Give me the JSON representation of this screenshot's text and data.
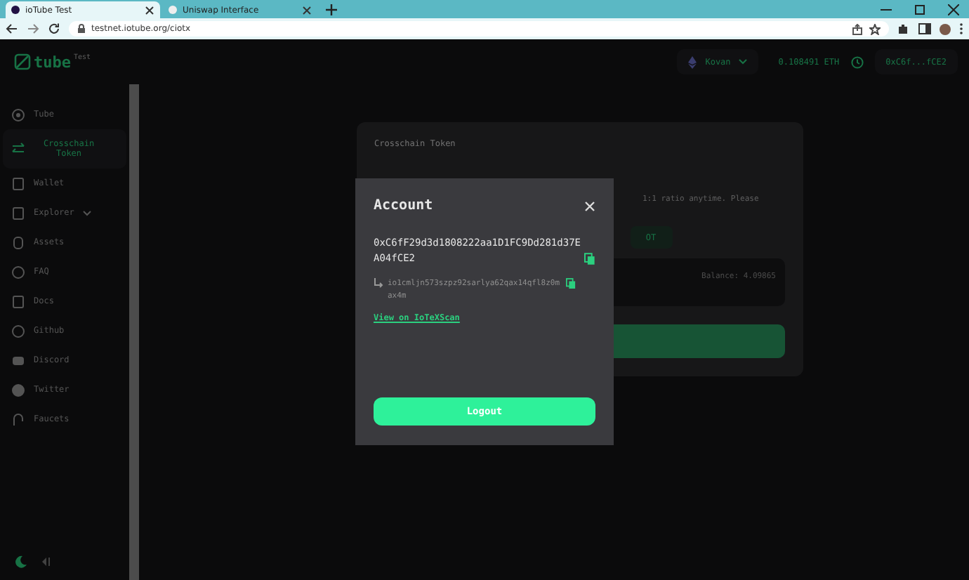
{
  "browser": {
    "tabs": [
      {
        "title": "ioTube Test",
        "selected": true
      },
      {
        "title": "Uniswap Interface",
        "selected": false
      }
    ],
    "url": "testnet.iotube.org/ciotx"
  },
  "header": {
    "logo": "tube",
    "logo_badge": "Test",
    "network": "Kovan",
    "balance": "0.108491 ETH",
    "account": "0xC6f...fCE2"
  },
  "sidebar": {
    "items": [
      {
        "label": "Tube",
        "kind": "link",
        "selected": false
      },
      {
        "label": "Crosschain Token",
        "kind": "link",
        "selected": true
      },
      {
        "label": "Wallet",
        "kind": "link",
        "selected": false
      },
      {
        "label": "Explorer",
        "kind": "group",
        "selected": false
      },
      {
        "label": "Assets",
        "kind": "link",
        "selected": false
      },
      {
        "label": "FAQ",
        "kind": "link",
        "selected": false
      },
      {
        "label": "Docs",
        "kind": "link",
        "selected": false
      },
      {
        "label": "Github",
        "kind": "link",
        "selected": false
      },
      {
        "label": "Discord",
        "kind": "link",
        "selected": false
      },
      {
        "label": "Twitter",
        "kind": "link",
        "selected": false
      },
      {
        "label": "Faucets",
        "kind": "link",
        "selected": false
      }
    ]
  },
  "card": {
    "title": "Crosschain Token",
    "text_fragment": "1:1 ratio anytime. Please",
    "button_fragment": "OT",
    "balance": "Balance: 4.09865"
  },
  "modal": {
    "title": "Account",
    "address": "0xC6fF29d3d1808222aa1D1FC9Dd281d37EA04fCE2",
    "iotex_address": "io1cmljn573szpz92sarlya62qax14qfl8z0max4m",
    "link": "View on IoTeXScan",
    "button": "Logout"
  }
}
